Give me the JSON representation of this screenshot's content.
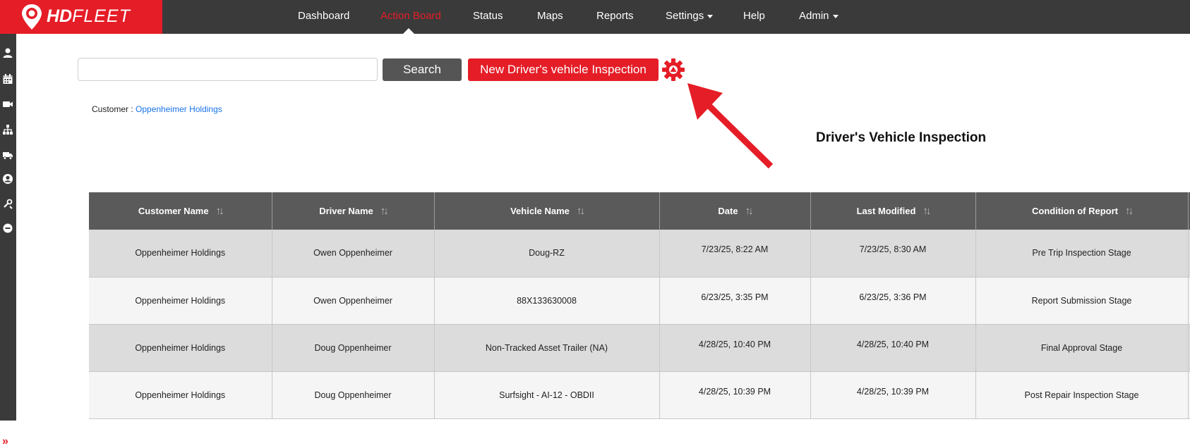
{
  "brand": {
    "logo_text_bold": "HD",
    "logo_text_light": "FLEET"
  },
  "nav": {
    "items": [
      {
        "label": "Dashboard"
      },
      {
        "label": "Action Board"
      },
      {
        "label": "Status"
      },
      {
        "label": "Maps"
      },
      {
        "label": "Reports"
      },
      {
        "label": "Settings"
      },
      {
        "label": "Help"
      },
      {
        "label": "Admin"
      }
    ],
    "active": "Action Board"
  },
  "toolbar": {
    "search_value": "",
    "search_label": "Search",
    "new_label": "New Driver's vehicle Inspection"
  },
  "customer": {
    "prefix": "Customer :",
    "name": "Oppenheimer Holdings"
  },
  "annotation": {
    "label": "Driver's Vehicle Inspection"
  },
  "table": {
    "headers": [
      "Customer Name",
      "Driver Name",
      "Vehicle Name",
      "Date",
      "Last Modified",
      "Condition of Report"
    ],
    "rows": [
      [
        "Oppenheimer Holdings",
        "Owen Oppenheimer",
        "Doug-RZ",
        "7/23/25, 8:22 AM",
        "7/23/25, 8:30 AM",
        "Pre Trip Inspection Stage"
      ],
      [
        "Oppenheimer Holdings",
        "Owen Oppenheimer",
        "88X133630008",
        "6/23/25, 3:35 PM",
        "6/23/25, 3:36 PM",
        "Report Submission Stage"
      ],
      [
        "Oppenheimer Holdings",
        "Doug Oppenheimer",
        "Non-Tracked Asset Trailer (NA)",
        "4/28/25, 10:40 PM",
        "4/28/25, 10:40 PM",
        "Final Approval Stage"
      ],
      [
        "Oppenheimer Holdings",
        "Doug Oppenheimer",
        "Surfsight - AI-12 - OBDII",
        "4/28/25, 10:39 PM",
        "4/28/25, 10:39 PM",
        "Post Repair Inspection Stage"
      ]
    ]
  },
  "colors": {
    "brand_red": "#e51d27",
    "bar_dark": "#3a3a3a",
    "header_gray": "#5a5a5a"
  },
  "icons": [
    "user-icon",
    "calendar-icon",
    "video-icon",
    "sitemap-icon",
    "truck-icon",
    "user-circle-icon",
    "tools-icon",
    "minus-circle-icon",
    "double-chevron-right-icon",
    "gear-icon",
    "sort-icon"
  ]
}
